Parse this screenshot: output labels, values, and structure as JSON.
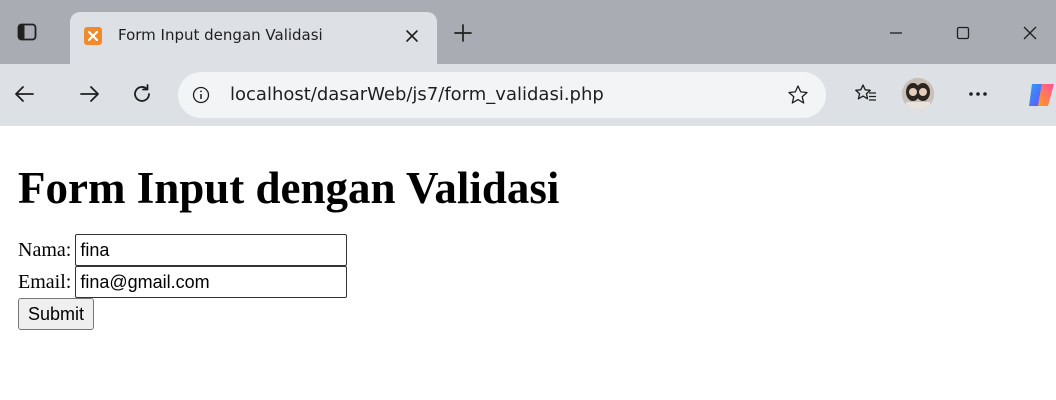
{
  "browser": {
    "tab": {
      "title": "Form Input dengan Validasi",
      "favicon": "xampp-favicon-icon"
    },
    "address_bar": {
      "url": "localhost/dasarWeb/js7/form_validasi.php"
    },
    "colors": {
      "titlebar": "#a9adb3",
      "toolbar": "#dde0e4",
      "favicon": "#f18a2c"
    }
  },
  "page": {
    "heading": "Form Input dengan Validasi",
    "form": {
      "nama_label": "Nama:",
      "nama_value": "fina",
      "email_label": "Email:",
      "email_value": "fina@gmail.com",
      "submit_label": "Submit"
    }
  }
}
